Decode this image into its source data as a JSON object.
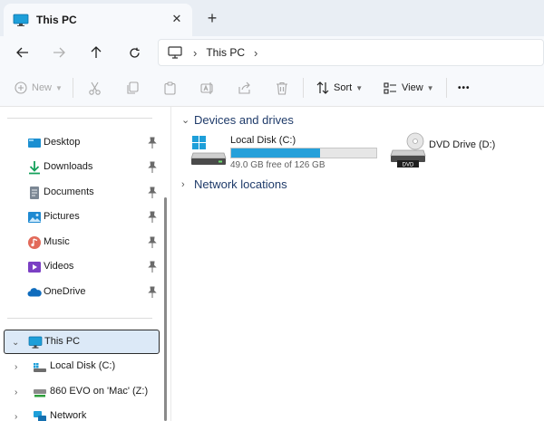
{
  "tab": {
    "title": "This PC",
    "close_glyph": "✕",
    "new_tab_glyph": "+"
  },
  "address": {
    "location": "This PC"
  },
  "toolbar": {
    "new_label": "New",
    "sort_label": "Sort",
    "view_label": "View",
    "more_glyph": "•••"
  },
  "sidebar": {
    "quick_access": [
      {
        "label": "Desktop",
        "icon": "desktop-icon"
      },
      {
        "label": "Downloads",
        "icon": "download-icon"
      },
      {
        "label": "Documents",
        "icon": "documents-icon"
      },
      {
        "label": "Pictures",
        "icon": "pictures-icon"
      },
      {
        "label": "Music",
        "icon": "music-icon"
      },
      {
        "label": "Videos",
        "icon": "videos-icon"
      },
      {
        "label": "OneDrive",
        "icon": "onedrive-icon"
      }
    ],
    "this_pc": {
      "label": "This PC",
      "icon": "pc-icon"
    },
    "children": [
      {
        "label": "Local Disk (C:)",
        "icon": "local-disk-icon"
      },
      {
        "label": "860 EVO on 'Mac' (Z:)",
        "icon": "network-drive-icon"
      },
      {
        "label": "Network",
        "icon": "network-icon"
      }
    ]
  },
  "main": {
    "devices_header": "Devices and drives",
    "network_header": "Network locations",
    "drives": [
      {
        "name": "Local Disk (C:)",
        "free_text": "49.0 GB free of 126 GB",
        "used_fraction": 0.611
      },
      {
        "name": "DVD Drive (D:)",
        "badge": "DVD"
      }
    ]
  },
  "colors": {
    "accent": "#26a0da",
    "selection": "#dce9f7",
    "header_text": "#1f3b6a"
  }
}
